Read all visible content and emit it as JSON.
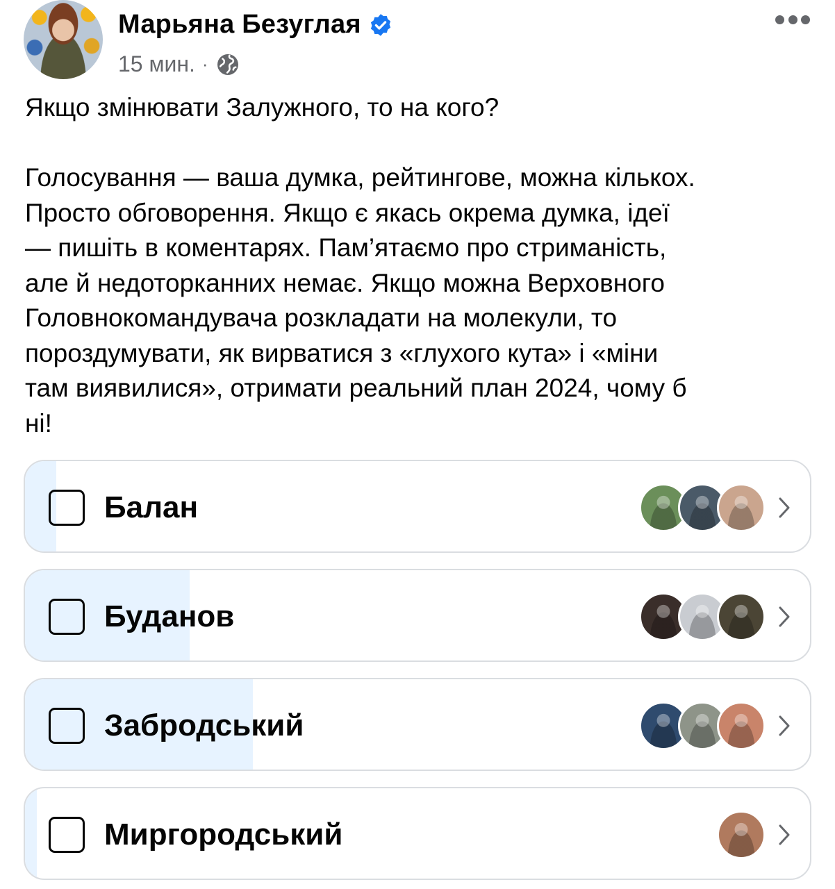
{
  "post": {
    "author": "Марьяна Безуглая",
    "time": "15 мин.",
    "separator": "·",
    "text": "Якщо змінювати Залужного, то на кого?\n\nГолосування — ваша думка, рейтингове, можна кількох.\nПросто обговорення. Якщо є якась окрема думка, ідеї\n— пишіть в коментарях. Пам’ятаємо про стриманість,\nале й недоторканних немає. Якщо можна Верховного\nГоловнокомандувача розкладати на молекули, то\nпороздумувати, як вирватися з «глухого кута» і «міни\nтам виявилися», отримати реальний план 2024, чому б\nні!"
  },
  "icons": {
    "verified": "verified-badge-icon",
    "audience": "globe-icon",
    "more": "more-options-icon",
    "option_chevron": "chevron-right-icon"
  },
  "colors": {
    "verified_blue": "#1877f2",
    "poll_fill": "#e7f3ff",
    "secondary_text": "#65676b",
    "border": "#dadde1"
  },
  "poll": {
    "options": [
      {
        "label": "Балан",
        "share": 0.04,
        "voters": [
          "#6b8f5a",
          "#4a5a68",
          "#caa58e"
        ]
      },
      {
        "label": "Буданов",
        "share": 0.21,
        "voters": [
          "#3a2e2a",
          "#c9ccd1",
          "#4b4535"
        ]
      },
      {
        "label": "Забродський",
        "share": 0.29,
        "voters": [
          "#2f4b6e",
          "#8e9489",
          "#c9846a"
        ]
      },
      {
        "label": "Миргородський",
        "share": 0.015,
        "voters": [
          "#b07a5e"
        ]
      }
    ]
  }
}
